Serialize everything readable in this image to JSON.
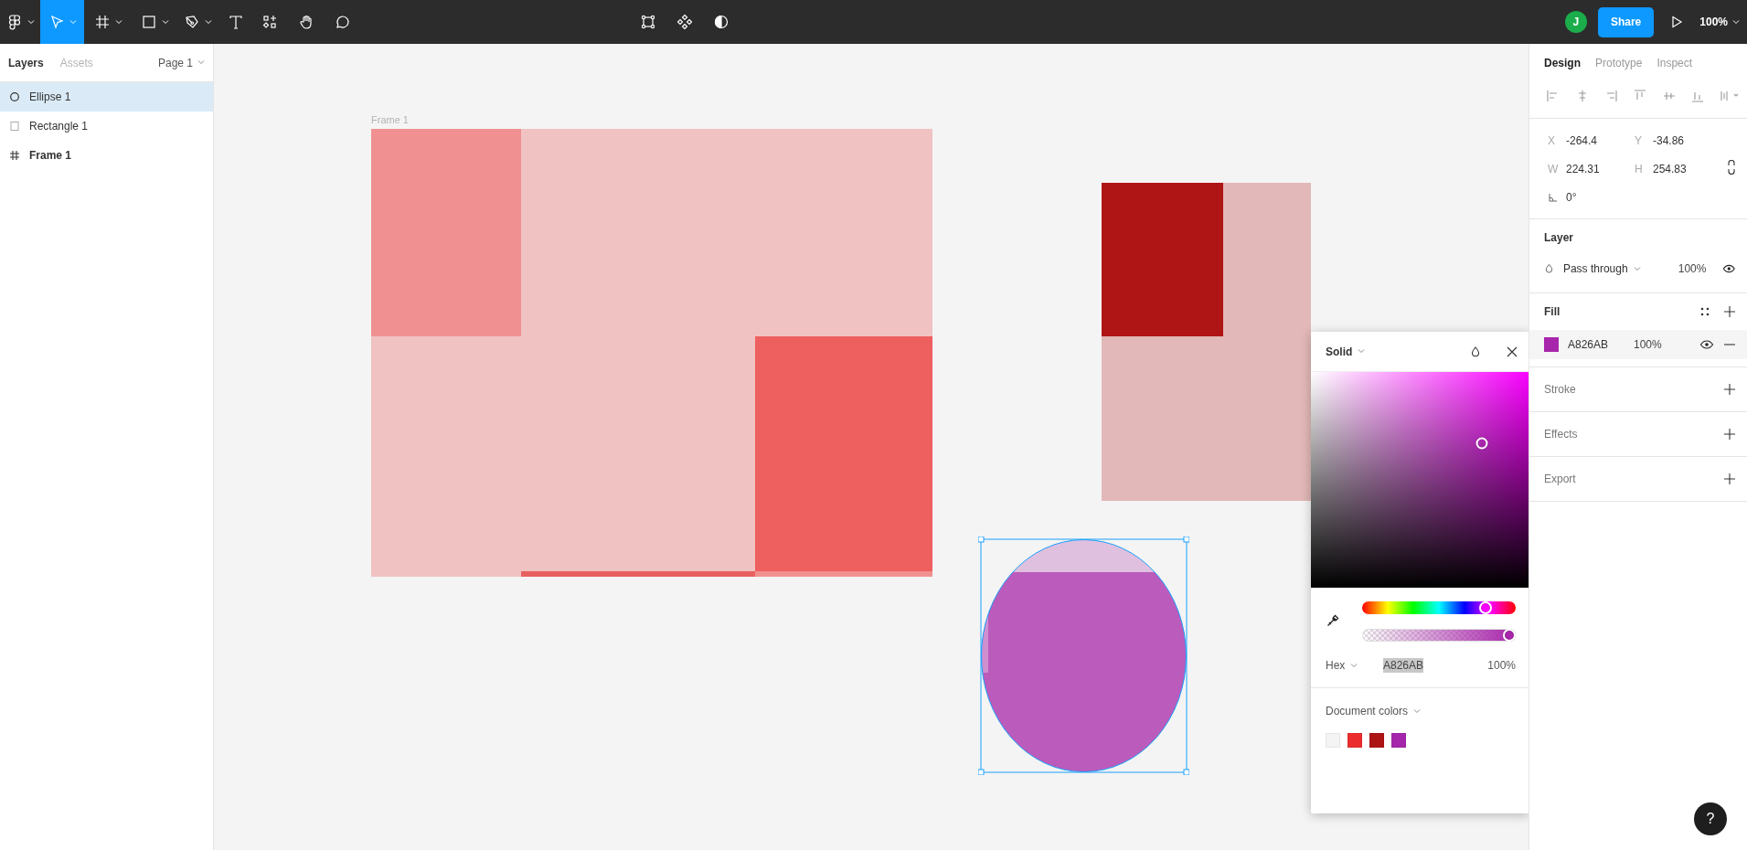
{
  "toolbar": {
    "tools": [
      {
        "kind": "logo",
        "selected": false
      },
      {
        "kind": "move",
        "selected": true
      },
      {
        "kind": "frame",
        "selected": false
      },
      {
        "kind": "rectangle",
        "selected": false
      },
      {
        "kind": "pen",
        "selected": false
      },
      {
        "kind": "text",
        "selected": false
      },
      {
        "kind": "resources",
        "selected": false
      },
      {
        "kind": "hand",
        "selected": false
      },
      {
        "kind": "comment",
        "selected": false
      }
    ],
    "center_tools": [
      {
        "kind": "edit-object"
      },
      {
        "kind": "component"
      },
      {
        "kind": "mask"
      }
    ],
    "avatar": "J",
    "share": "Share",
    "zoom": "100%"
  },
  "layers_panel": {
    "tabs": [
      {
        "label": "Layers",
        "selected": true
      },
      {
        "label": "Assets",
        "selected": false
      }
    ],
    "page": "Page 1",
    "layers": [
      {
        "kind": "ellipse",
        "name": "Ellipse 1",
        "selected": true
      },
      {
        "kind": "rectangle",
        "name": "Rectangle 1",
        "selected": false
      },
      {
        "kind": "frame",
        "name": "Frame 1",
        "selected": false
      }
    ]
  },
  "canvas": {
    "frame_label": "Frame 1"
  },
  "color_picker": {
    "mode": "Solid",
    "hex": "A826AB",
    "format": "Hex",
    "opacity": "100%",
    "hue": {
      "level": 0.83
    },
    "alpha": {
      "level": 1
    },
    "document_colors": {
      "label": "Document colors",
      "swatches": [
        {
          "color": "#f4f4f4"
        },
        {
          "color": "#eb2d2d"
        },
        {
          "color": "#ad1515"
        },
        {
          "color": "#a526ab"
        }
      ]
    }
  },
  "design_panel": {
    "tabs": [
      {
        "label": "Design",
        "selected": true
      },
      {
        "label": "Prototype",
        "selected": false
      },
      {
        "label": "Inspect",
        "selected": false
      }
    ],
    "position": [
      {
        "label": "X",
        "value": "-264.4"
      },
      {
        "label": "Y",
        "value": "-34.86"
      },
      {
        "label": "W",
        "value": "224.31"
      },
      {
        "label": "H",
        "value": "254.83"
      }
    ],
    "rotation": "0°",
    "layer": {
      "title": "Layer",
      "blend": "Pass through",
      "opacity": "100%"
    },
    "fill": {
      "title": "Fill",
      "color": "#a826ab",
      "hex": "A826AB",
      "opacity": "100%"
    },
    "sections": [
      {
        "label": "Stroke"
      },
      {
        "label": "Effects"
      },
      {
        "label": "Export"
      }
    ]
  },
  "help": "?"
}
